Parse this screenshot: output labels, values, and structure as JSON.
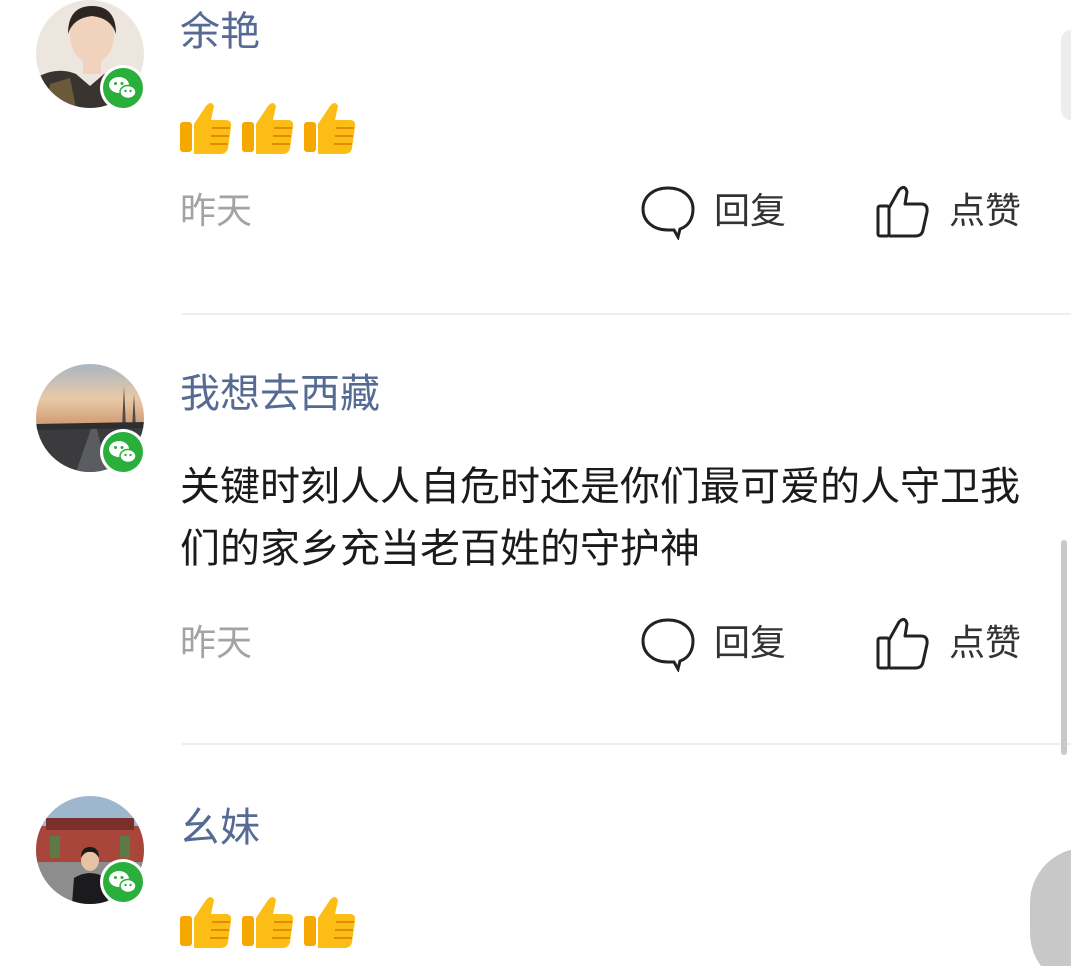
{
  "comments": [
    {
      "username": "余艳",
      "avatar": "avatar-woman-portrait",
      "badge": "wechat-icon",
      "content": "",
      "emoji": [
        "thumbs-up",
        "thumbs-up",
        "thumbs-up"
      ],
      "time": "昨天",
      "reply_label": "回复",
      "like_label": "点赞"
    },
    {
      "username": "我想去西藏",
      "avatar": "avatar-sunset-road",
      "badge": "wechat-icon",
      "content": "关键时刻人人自危时还是你们最可爱的人守卫我们的家乡充当老百姓的守护神",
      "emoji": [],
      "time": "昨天",
      "reply_label": "回复",
      "like_label": "点赞"
    },
    {
      "username": "幺妹",
      "avatar": "avatar-person-at-gate",
      "badge": "wechat-icon",
      "content": "",
      "emoji": [
        "thumbs-up",
        "thumbs-up",
        "thumbs-up"
      ],
      "time": "",
      "reply_label": "",
      "like_label": ""
    }
  ],
  "colors": {
    "username": "#566b94",
    "time": "#a3a3a3",
    "wechat_green": "#2aae3c",
    "emoji_yellow": "#f7b500"
  }
}
